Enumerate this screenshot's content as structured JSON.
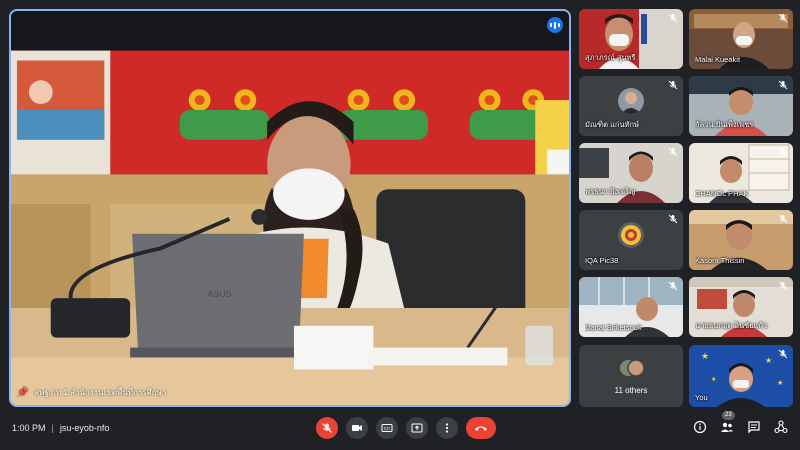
{
  "main": {
    "participant_name": "สพฐ.กท 1 สำนักงานเขตพื้นที่การศึกษา",
    "laptop_logo": "ASUS"
  },
  "tiles": [
    {
      "name": "สุภาภรณ์ สุนทรี"
    },
    {
      "name": "Malai Kueakit"
    },
    {
      "name": "มัณฑิต แก่นทักษ์"
    },
    {
      "name": "กัลวน ปันเพ็งเพชร"
    },
    {
      "name": "พรธนา ยิ่งเจริญ"
    },
    {
      "name": "CHANOL PHAK"
    },
    {
      "name": "IQA Pic38"
    },
    {
      "name": "Kasora Thissin"
    },
    {
      "name": "Danai Sriketsook"
    },
    {
      "name": "นายธนกฤต อินชัยแก้ว"
    },
    {
      "name": "11 others"
    },
    {
      "name": "You"
    }
  ],
  "bottom": {
    "time": "1:00 PM",
    "separator": "|",
    "meeting_code": "jsu-eyob-nfo",
    "participant_count": "23"
  },
  "colors": {
    "accent": "#8ab4f8",
    "end_call": "#ea4335",
    "tile_bg": "#3c4043"
  }
}
